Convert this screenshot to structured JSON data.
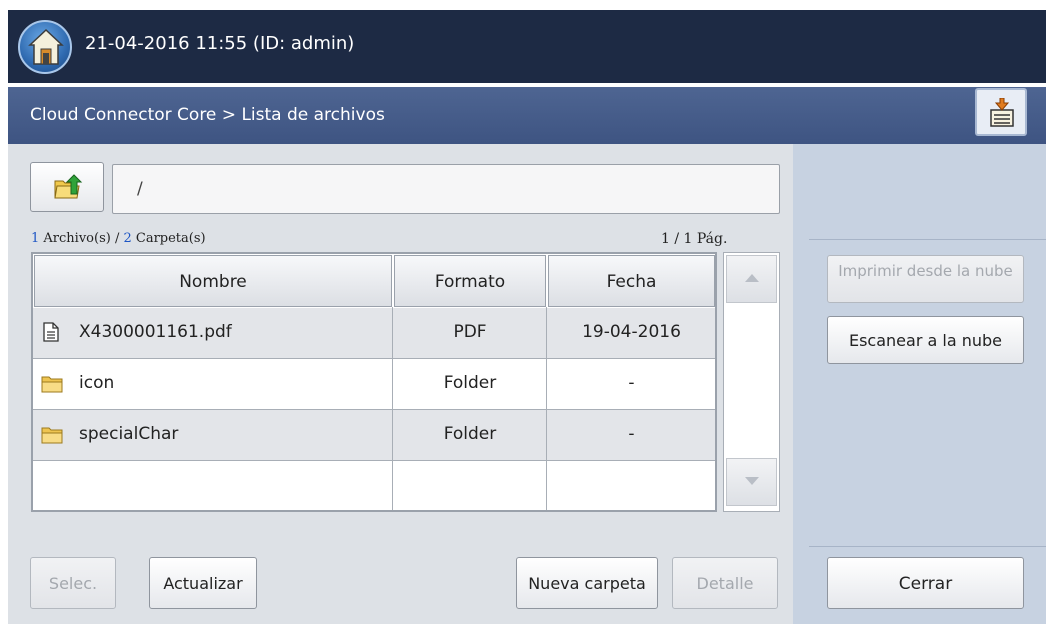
{
  "header": {
    "datetime_user": "21-04-2016 11:55 (ID: admin)"
  },
  "subheader": {
    "breadcrumb": "Cloud Connector Core > Lista de archivos"
  },
  "path": {
    "value": "/"
  },
  "summary": {
    "files_count": "1",
    "files_label": " Archivo(s) / ",
    "folders_count": "2",
    "folders_label": " Carpeta(s)",
    "page": "1 / 1 Pág."
  },
  "table": {
    "columns": [
      "Nombre",
      "Formato",
      "Fecha"
    ],
    "rows": [
      {
        "name": "X4300001161.pdf",
        "format": "PDF",
        "date": "19-04-2016",
        "icon": "document-icon"
      },
      {
        "name": "icon",
        "format": "Folder",
        "date": "-",
        "icon": "folder-icon"
      },
      {
        "name": "specialChar",
        "format": "Folder",
        "date": "-",
        "icon": "folder-icon"
      }
    ]
  },
  "buttons": {
    "select": "Selec.",
    "refresh": "Actualizar",
    "new_folder": "Nueva carpeta",
    "detail": "Detalle",
    "print_cloud": "Imprimir desde la nube",
    "scan_cloud": "Escanear a la nube",
    "close": "Cerrar"
  },
  "colors": {
    "topbar": "#1d2a44",
    "subbar": "#4e6592",
    "panel": "#dde1e6",
    "side_panel": "#c7d2e1",
    "link_number": "#1d55c4"
  }
}
